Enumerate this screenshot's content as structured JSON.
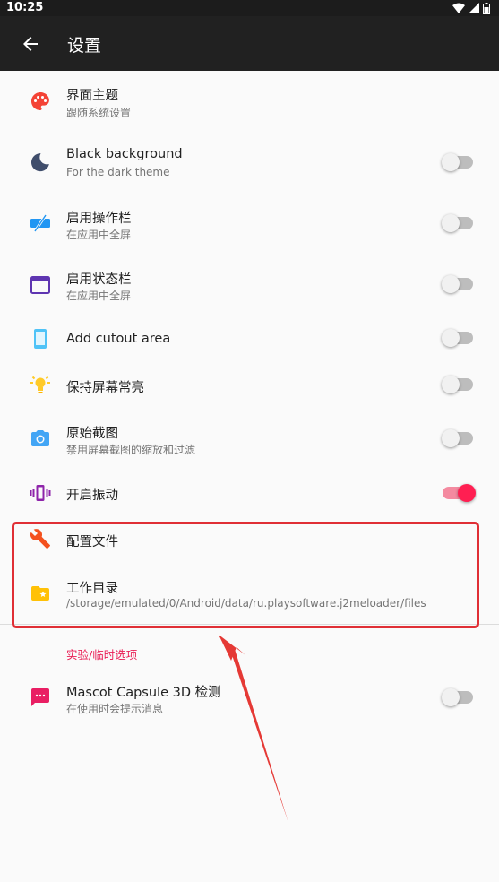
{
  "status_bar": {
    "time": "10:25",
    "icons": [
      "wifi-icon",
      "signal-icon",
      "battery-icon"
    ]
  },
  "app_bar": {
    "title": "设置",
    "back_icon": "arrow-back-icon"
  },
  "settings": [
    {
      "id": "theme",
      "title": "界面主题",
      "subtitle": "跟随系统设置",
      "icon": "palette-icon",
      "icon_color": "#f44336"
    },
    {
      "id": "black-background",
      "title": "Black background",
      "subtitle": "For the dark theme",
      "icon": "moon-icon",
      "icon_color": "#3f4d6b",
      "switch_on": false
    },
    {
      "id": "action-bar",
      "title": "启用操作栏",
      "subtitle": "在应用中全屏",
      "icon": "fullscreen-off-icon",
      "icon_color": "#2196f3",
      "switch_on": false
    },
    {
      "id": "status-bar",
      "title": "启用状态栏",
      "subtitle": "在应用中全屏",
      "icon": "window-icon",
      "icon_color": "#5e35b1",
      "switch_on": false
    },
    {
      "id": "cutout",
      "title": "Add cutout area",
      "icon": "phone-icon",
      "icon_color": "#4fc3f7",
      "switch_on": false
    },
    {
      "id": "keep-screen-on",
      "title": "保持屏幕常亮",
      "icon": "lightbulb-icon",
      "icon_color": "#ffb300",
      "switch_on": false
    },
    {
      "id": "raw-screenshot",
      "title": "原始截图",
      "subtitle": "禁用屏幕截图的缩放和过滤",
      "icon": "camera-icon",
      "icon_color": "#42a5f5",
      "switch_on": false
    },
    {
      "id": "vibration",
      "title": "开启振动",
      "icon": "vibration-icon",
      "icon_color": "#8e24aa",
      "switch_on": true
    },
    {
      "id": "profiles",
      "title": "配置文件",
      "icon": "wrench-icon",
      "icon_color": "#f4511e"
    },
    {
      "id": "work-dir",
      "title": "工作目录",
      "subtitle": "/storage/emulated/0/Android/data/ru.playsoftware.j2meloader/files",
      "icon": "folder-star-icon",
      "icon_color": "#ffc107"
    }
  ],
  "experimental": {
    "category_title": "实验/临时选项",
    "items": [
      {
        "id": "mascot-capsule",
        "title": "Mascot Capsule 3D 检测",
        "subtitle": "在使用时会提示消息",
        "icon": "message-icon",
        "icon_color": "#e91e63",
        "switch_on": false
      }
    ]
  },
  "colors": {
    "accent": "#ff1f52",
    "app_bar": "#212121",
    "highlight": "#e02f35"
  }
}
